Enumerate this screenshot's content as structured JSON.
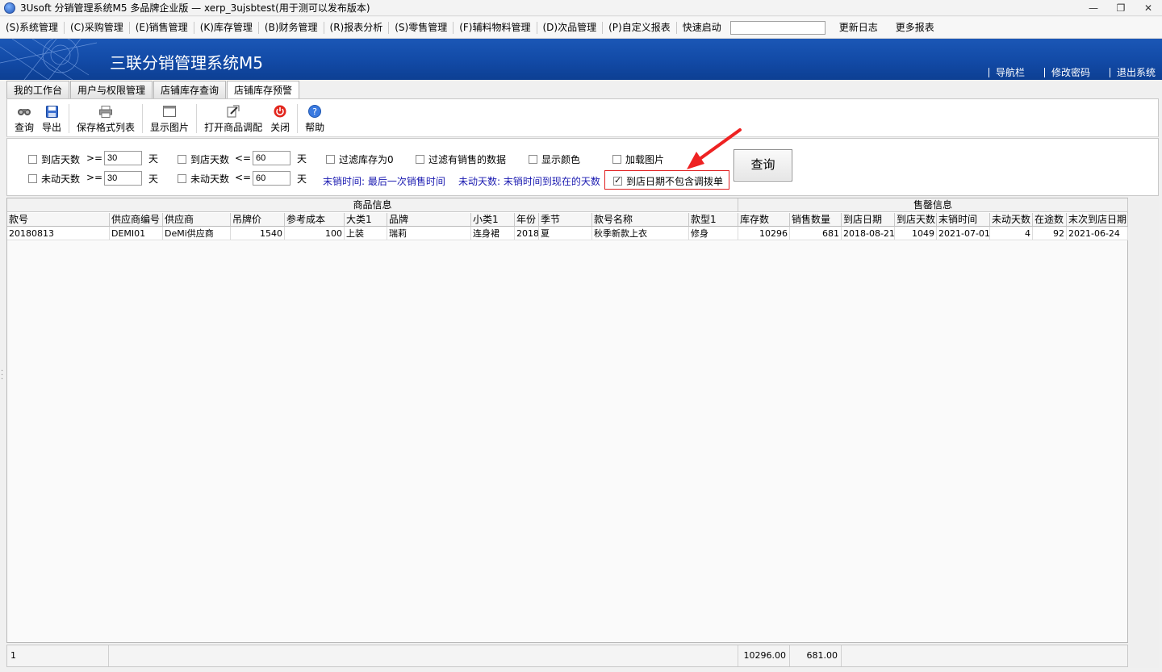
{
  "window": {
    "title": "3Usoft 分销管理系统M5 多品牌企业版 — xerp_3ujsbtest(用于测可以发布版本)",
    "controls": [
      "—",
      "❐",
      "✕"
    ]
  },
  "menu": {
    "items": [
      "(S)系统管理",
      "(C)采购管理",
      "(E)销售管理",
      "(K)库存管理",
      "(B)财务管理",
      "(R)报表分析",
      "(S)零售管理",
      "(F)辅料物料管理",
      "(D)次品管理",
      "(P)自定义报表"
    ],
    "quick_start_label": "快速启动",
    "quick_start_value": "",
    "update_log": "更新日志",
    "more_reports": "更多报表"
  },
  "banner": {
    "title": "三联分销管理系统M5",
    "links": [
      "导航栏",
      "修改密码",
      "退出系统"
    ],
    "bg_color": "#124aa6"
  },
  "tabs": [
    "我的工作台",
    "用户与权限管理",
    "店铺库存查询",
    "店铺库存预警"
  ],
  "active_tab_index": 3,
  "toolbar": {
    "query": "查询",
    "export": "导出",
    "save_format": "保存格式列表",
    "show_image": "显示图片",
    "open_allocation": "打开商品调配",
    "close": "关闭",
    "help": "帮助"
  },
  "filters": {
    "row1": {
      "days_in_store_ge_label": "到店天数",
      "days_in_store_ge_op": ">=",
      "days_in_store_ge_value": "30",
      "days_in_store_ge_checked": false,
      "days_in_store_le_label": "到店天数",
      "days_in_store_le_op": "<=",
      "days_in_store_le_value": "60",
      "days_in_store_le_checked": false,
      "unit": "天"
    },
    "row2": {
      "idle_days_ge_label": "未动天数",
      "idle_days_ge_op": ">=",
      "idle_days_ge_value": "30",
      "idle_days_ge_checked": false,
      "idle_days_le_label": "未动天数",
      "idle_days_le_op": "<=",
      "idle_days_le_value": "60",
      "idle_days_le_checked": false,
      "unit": "天"
    },
    "filter_zero_stock": "过滤库存为0",
    "filter_with_sales": "过滤有销售的数据",
    "show_color": "显示颜色",
    "load_image": "加载图片",
    "note_last_sale": "末销时间: 最后一次销售时间",
    "note_idle_days": "未动天数: 末销时间到现在的天数",
    "exclude_transfer": "到店日期不包含调拨单",
    "exclude_transfer_checked": true,
    "query_button": "查询"
  },
  "grid": {
    "groups": [
      "商品信息",
      "售罄信息"
    ],
    "columns": [
      "款号",
      "供应商编号",
      "供应商",
      "吊牌价",
      "参考成本",
      "大类1",
      "品牌",
      "小类1",
      "年份",
      "季节",
      "款号名称",
      "款型1",
      "库存数",
      "销售数量",
      "到店日期",
      "到店天数",
      "末销时间",
      "未动天数",
      "在途数",
      "末次到店日期"
    ],
    "rows": [
      [
        "20180813",
        "DEMI01",
        "DeMi供应商",
        "1540",
        "100",
        "上装",
        "瑞莉",
        "连身裙",
        "2018",
        "夏",
        "秋季新款上衣",
        "修身",
        "10296",
        "681",
        "2018-08-21",
        "1049",
        "2021-07-01",
        "4",
        "92",
        "2021-06-24"
      ]
    ]
  },
  "footer": {
    "count": "1",
    "stock_total": "10296.00",
    "sales_total": "681.00"
  }
}
